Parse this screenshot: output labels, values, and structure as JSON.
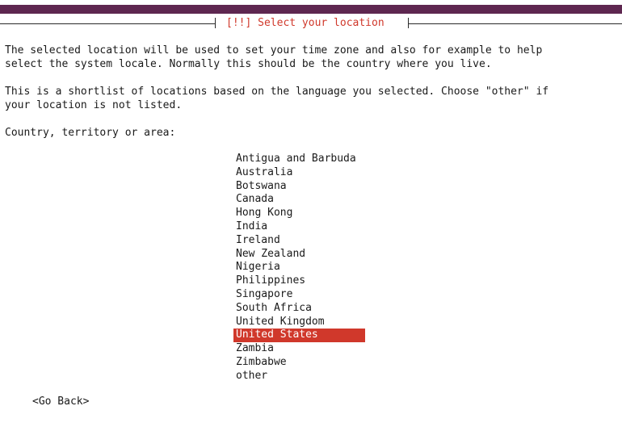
{
  "dialog": {
    "title": "[!!] Select your location"
  },
  "description": {
    "line1": "The selected location will be used to set your time zone and also for example to help",
    "line2": "select the system locale. Normally this should be the country where you live.",
    "line3": "This is a shortlist of locations based on the language you selected. Choose \"other\" if",
    "line4": "your location is not listed."
  },
  "field": {
    "label": "Country, territory or area:"
  },
  "locations": [
    {
      "label": "Antigua and Barbuda",
      "selected": false
    },
    {
      "label": "Australia",
      "selected": false
    },
    {
      "label": "Botswana",
      "selected": false
    },
    {
      "label": "Canada",
      "selected": false
    },
    {
      "label": "Hong Kong",
      "selected": false
    },
    {
      "label": "India",
      "selected": false
    },
    {
      "label": "Ireland",
      "selected": false
    },
    {
      "label": "New Zealand",
      "selected": false
    },
    {
      "label": "Nigeria",
      "selected": false
    },
    {
      "label": "Philippines",
      "selected": false
    },
    {
      "label": "Singapore",
      "selected": false
    },
    {
      "label": "South Africa",
      "selected": false
    },
    {
      "label": "United Kingdom",
      "selected": false
    },
    {
      "label": "United States",
      "selected": true
    },
    {
      "label": "Zambia",
      "selected": false
    },
    {
      "label": "Zimbabwe",
      "selected": false
    },
    {
      "label": "other",
      "selected": false
    }
  ],
  "actions": {
    "back_label": "<Go Back>"
  },
  "colors": {
    "header_bar": "#5e2750",
    "accent": "#d0382b"
  }
}
